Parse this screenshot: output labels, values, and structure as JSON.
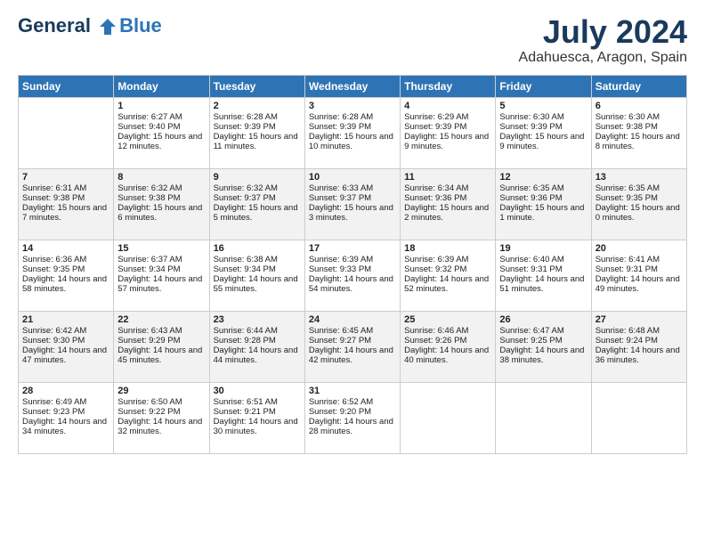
{
  "header": {
    "logo_line1": "General",
    "logo_line2": "Blue",
    "title": "July 2024",
    "subtitle": "Adahuesca, Aragon, Spain"
  },
  "days_of_week": [
    "Sunday",
    "Monday",
    "Tuesday",
    "Wednesday",
    "Thursday",
    "Friday",
    "Saturday"
  ],
  "weeks": [
    [
      {
        "day": "",
        "sunrise": "",
        "sunset": "",
        "daylight": ""
      },
      {
        "day": "1",
        "sunrise": "Sunrise: 6:27 AM",
        "sunset": "Sunset: 9:40 PM",
        "daylight": "Daylight: 15 hours and 12 minutes."
      },
      {
        "day": "2",
        "sunrise": "Sunrise: 6:28 AM",
        "sunset": "Sunset: 9:39 PM",
        "daylight": "Daylight: 15 hours and 11 minutes."
      },
      {
        "day": "3",
        "sunrise": "Sunrise: 6:28 AM",
        "sunset": "Sunset: 9:39 PM",
        "daylight": "Daylight: 15 hours and 10 minutes."
      },
      {
        "day": "4",
        "sunrise": "Sunrise: 6:29 AM",
        "sunset": "Sunset: 9:39 PM",
        "daylight": "Daylight: 15 hours and 9 minutes."
      },
      {
        "day": "5",
        "sunrise": "Sunrise: 6:30 AM",
        "sunset": "Sunset: 9:39 PM",
        "daylight": "Daylight: 15 hours and 9 minutes."
      },
      {
        "day": "6",
        "sunrise": "Sunrise: 6:30 AM",
        "sunset": "Sunset: 9:38 PM",
        "daylight": "Daylight: 15 hours and 8 minutes."
      }
    ],
    [
      {
        "day": "7",
        "sunrise": "Sunrise: 6:31 AM",
        "sunset": "Sunset: 9:38 PM",
        "daylight": "Daylight: 15 hours and 7 minutes."
      },
      {
        "day": "8",
        "sunrise": "Sunrise: 6:32 AM",
        "sunset": "Sunset: 9:38 PM",
        "daylight": "Daylight: 15 hours and 6 minutes."
      },
      {
        "day": "9",
        "sunrise": "Sunrise: 6:32 AM",
        "sunset": "Sunset: 9:37 PM",
        "daylight": "Daylight: 15 hours and 5 minutes."
      },
      {
        "day": "10",
        "sunrise": "Sunrise: 6:33 AM",
        "sunset": "Sunset: 9:37 PM",
        "daylight": "Daylight: 15 hours and 3 minutes."
      },
      {
        "day": "11",
        "sunrise": "Sunrise: 6:34 AM",
        "sunset": "Sunset: 9:36 PM",
        "daylight": "Daylight: 15 hours and 2 minutes."
      },
      {
        "day": "12",
        "sunrise": "Sunrise: 6:35 AM",
        "sunset": "Sunset: 9:36 PM",
        "daylight": "Daylight: 15 hours and 1 minute."
      },
      {
        "day": "13",
        "sunrise": "Sunrise: 6:35 AM",
        "sunset": "Sunset: 9:35 PM",
        "daylight": "Daylight: 15 hours and 0 minutes."
      }
    ],
    [
      {
        "day": "14",
        "sunrise": "Sunrise: 6:36 AM",
        "sunset": "Sunset: 9:35 PM",
        "daylight": "Daylight: 14 hours and 58 minutes."
      },
      {
        "day": "15",
        "sunrise": "Sunrise: 6:37 AM",
        "sunset": "Sunset: 9:34 PM",
        "daylight": "Daylight: 14 hours and 57 minutes."
      },
      {
        "day": "16",
        "sunrise": "Sunrise: 6:38 AM",
        "sunset": "Sunset: 9:34 PM",
        "daylight": "Daylight: 14 hours and 55 minutes."
      },
      {
        "day": "17",
        "sunrise": "Sunrise: 6:39 AM",
        "sunset": "Sunset: 9:33 PM",
        "daylight": "Daylight: 14 hours and 54 minutes."
      },
      {
        "day": "18",
        "sunrise": "Sunrise: 6:39 AM",
        "sunset": "Sunset: 9:32 PM",
        "daylight": "Daylight: 14 hours and 52 minutes."
      },
      {
        "day": "19",
        "sunrise": "Sunrise: 6:40 AM",
        "sunset": "Sunset: 9:31 PM",
        "daylight": "Daylight: 14 hours and 51 minutes."
      },
      {
        "day": "20",
        "sunrise": "Sunrise: 6:41 AM",
        "sunset": "Sunset: 9:31 PM",
        "daylight": "Daylight: 14 hours and 49 minutes."
      }
    ],
    [
      {
        "day": "21",
        "sunrise": "Sunrise: 6:42 AM",
        "sunset": "Sunset: 9:30 PM",
        "daylight": "Daylight: 14 hours and 47 minutes."
      },
      {
        "day": "22",
        "sunrise": "Sunrise: 6:43 AM",
        "sunset": "Sunset: 9:29 PM",
        "daylight": "Daylight: 14 hours and 45 minutes."
      },
      {
        "day": "23",
        "sunrise": "Sunrise: 6:44 AM",
        "sunset": "Sunset: 9:28 PM",
        "daylight": "Daylight: 14 hours and 44 minutes."
      },
      {
        "day": "24",
        "sunrise": "Sunrise: 6:45 AM",
        "sunset": "Sunset: 9:27 PM",
        "daylight": "Daylight: 14 hours and 42 minutes."
      },
      {
        "day": "25",
        "sunrise": "Sunrise: 6:46 AM",
        "sunset": "Sunset: 9:26 PM",
        "daylight": "Daylight: 14 hours and 40 minutes."
      },
      {
        "day": "26",
        "sunrise": "Sunrise: 6:47 AM",
        "sunset": "Sunset: 9:25 PM",
        "daylight": "Daylight: 14 hours and 38 minutes."
      },
      {
        "day": "27",
        "sunrise": "Sunrise: 6:48 AM",
        "sunset": "Sunset: 9:24 PM",
        "daylight": "Daylight: 14 hours and 36 minutes."
      }
    ],
    [
      {
        "day": "28",
        "sunrise": "Sunrise: 6:49 AM",
        "sunset": "Sunset: 9:23 PM",
        "daylight": "Daylight: 14 hours and 34 minutes."
      },
      {
        "day": "29",
        "sunrise": "Sunrise: 6:50 AM",
        "sunset": "Sunset: 9:22 PM",
        "daylight": "Daylight: 14 hours and 32 minutes."
      },
      {
        "day": "30",
        "sunrise": "Sunrise: 6:51 AM",
        "sunset": "Sunset: 9:21 PM",
        "daylight": "Daylight: 14 hours and 30 minutes."
      },
      {
        "day": "31",
        "sunrise": "Sunrise: 6:52 AM",
        "sunset": "Sunset: 9:20 PM",
        "daylight": "Daylight: 14 hours and 28 minutes."
      },
      {
        "day": "",
        "sunrise": "",
        "sunset": "",
        "daylight": ""
      },
      {
        "day": "",
        "sunrise": "",
        "sunset": "",
        "daylight": ""
      },
      {
        "day": "",
        "sunrise": "",
        "sunset": "",
        "daylight": ""
      }
    ]
  ]
}
